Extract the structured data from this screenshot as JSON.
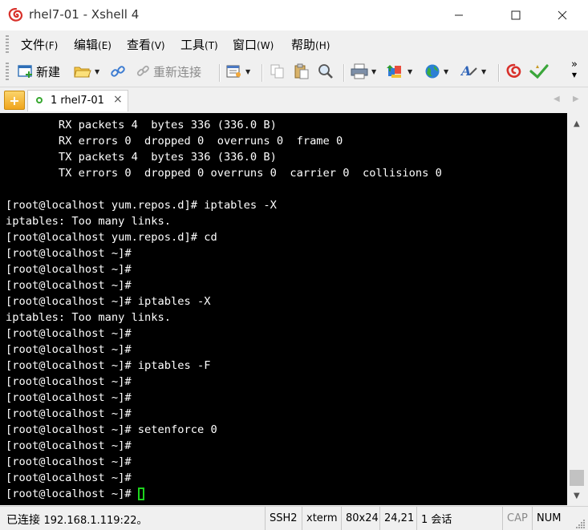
{
  "window": {
    "title": "rhel7-01 - Xshell 4",
    "minimize_icon": "minimize-icon",
    "maximize_icon": "maximize-icon",
    "close_icon": "close-icon"
  },
  "menu": {
    "items": [
      {
        "label": "文件",
        "key": "(F)"
      },
      {
        "label": "编辑",
        "key": "(E)"
      },
      {
        "label": "查看",
        "key": "(V)"
      },
      {
        "label": "工具",
        "key": "(T)"
      },
      {
        "label": "窗口",
        "key": "(W)"
      },
      {
        "label": "帮助",
        "key": "(H)"
      }
    ]
  },
  "toolbar": {
    "new_label": "新建",
    "reconnect_label": "重新连接",
    "overflow_label": "»"
  },
  "tabs": {
    "add_label": "+",
    "active_label": "1 rhel7-01",
    "close_label": "×",
    "prev_label": "◀",
    "next_label": "▶"
  },
  "terminal": {
    "lines": [
      "        RX packets 4  bytes 336 (336.0 B)",
      "        RX errors 0  dropped 0  overruns 0  frame 0",
      "        TX packets 4  bytes 336 (336.0 B)",
      "        TX errors 0  dropped 0 overruns 0  carrier 0  collisions 0",
      "",
      "[root@localhost yum.repos.d]# iptables -X",
      "iptables: Too many links.",
      "[root@localhost yum.repos.d]# cd",
      "[root@localhost ~]#",
      "[root@localhost ~]#",
      "[root@localhost ~]#",
      "[root@localhost ~]# iptables -X",
      "iptables: Too many links.",
      "[root@localhost ~]#",
      "[root@localhost ~]#",
      "[root@localhost ~]# iptables -F",
      "[root@localhost ~]#",
      "[root@localhost ~]#",
      "[root@localhost ~]#",
      "[root@localhost ~]# setenforce 0",
      "[root@localhost ~]#",
      "[root@localhost ~]#",
      "[root@localhost ~]#",
      "[root@localhost ~]# "
    ],
    "background": "#000000",
    "foreground": "#ffffff",
    "cursor_color": "#1dd41d"
  },
  "scrollbar": {
    "up_label": "▲",
    "down_label": "▼"
  },
  "status": {
    "connected_label": "已连接",
    "connected_host": "192.168.1.119:22。",
    "protocol": "SSH2",
    "terminal_type": "xterm",
    "size": "80x24",
    "cursor_pos": "24,21",
    "sessions": "1 会话",
    "caps": "CAP",
    "num": "NUM"
  }
}
